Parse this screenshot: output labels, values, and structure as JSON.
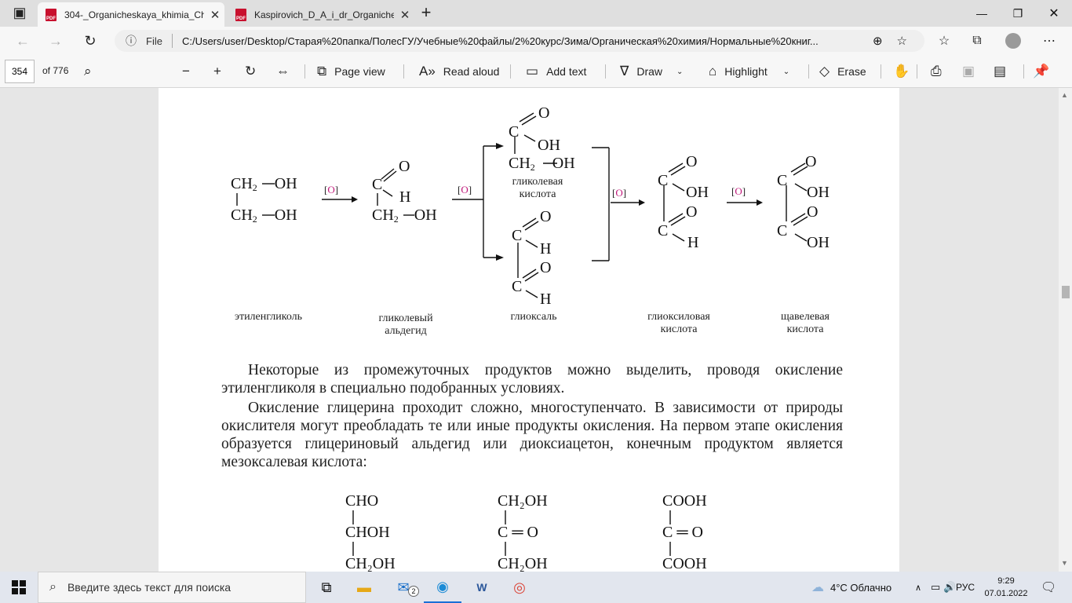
{
  "browser": {
    "tabs": [
      {
        "label": "304-_Organicheskaya_khimia_Ch",
        "close": "✕",
        "active": true
      },
      {
        "label": "Kaspirovich_D_A_i_dr_Organiche",
        "close": "✕",
        "active": false
      }
    ],
    "new_tab": "+",
    "address": {
      "scheme_label": "File",
      "url": "C:/Users/user/Desktop/Старая%20папка/ПолесГУ/Учебные%20файлы/2%20курс/Зима/Органическая%20химия/Нормальные%20книг..."
    }
  },
  "pdf_toolbar": {
    "page_number": "354",
    "page_of": "of 776",
    "page_view": "Page view",
    "read_aloud": "Read aloud",
    "add_text": "Add text",
    "draw": "Draw",
    "highlight": "Highlight",
    "erase": "Erase"
  },
  "document": {
    "oxidant_label": "O",
    "caption_ethylene_glycol": "этиленгликоль",
    "caption_glycol_aldehyde_1": "гликолевый",
    "caption_glycol_aldehyde_2": "альдегид",
    "caption_glycolic_acid_1": "гликолевая",
    "caption_glycolic_acid_2": "кислота",
    "caption_glyoxal": "глиоксаль",
    "caption_glyoxylic_1": "глиоксиловая",
    "caption_glyoxylic_2": "кислота",
    "caption_oxalic_1": "щавелевая",
    "caption_oxalic_2": "кислота",
    "paragraph_1": "Некоторые из промежуточных продуктов можно выделить, проводя окисле­ние этиленгликоля в специально подобранных условиях.",
    "paragraph_2": "Окисление глицерина проходит сложно, многоступенчато. В зависимости от природы окислителя могут преобладать те или иные продукты окисления. На первом этапе окисления образуется глицериновый альдегид или диоксиацетон, конечным продуктом является мезоксалевая кислота:",
    "formula_cho": "CHO",
    "formula_choh": "CHOH",
    "formula_ch2oh_bottom_1": "CH₂OH",
    "formula_ch2oh_top": "CH₂OH",
    "formula_c_eq_o_1": "C ═ O",
    "formula_ch2oh_bottom_2": "CH₂OH",
    "formula_cooh_top": "COOH",
    "formula_c_eq_o_2": "C ═ O",
    "formula_cooh_bottom": "COOH"
  },
  "taskbar": {
    "search_placeholder": "Введите здесь текст для поиска",
    "mail_badge": "2",
    "weather": "4°C  Облачно",
    "language": "РУС",
    "time": "9:29",
    "date": "07.01.2022"
  },
  "colors": {
    "oxidant_accent": "#c0187a",
    "pdf_icon": "#c8102e"
  }
}
